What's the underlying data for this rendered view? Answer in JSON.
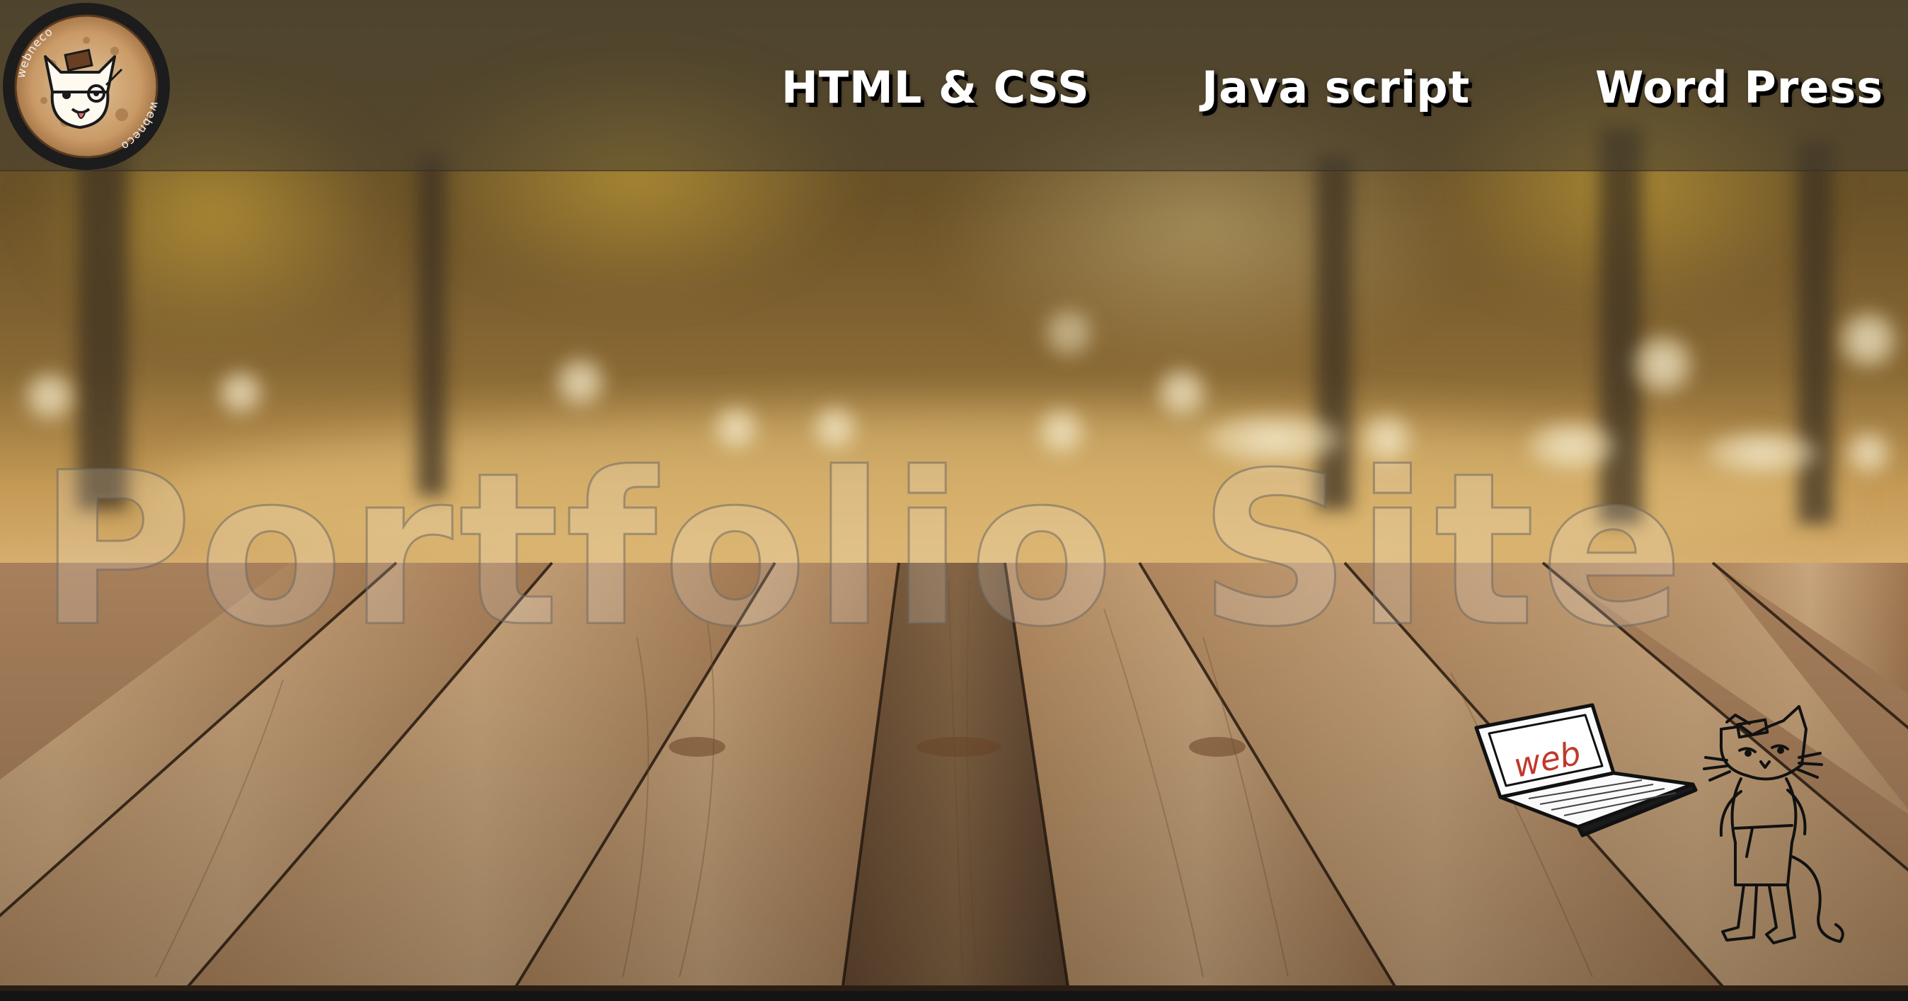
{
  "header": {
    "logo": {
      "name": "webneco cat logo",
      "text_top": "webneco",
      "text_bottom": "webneco"
    },
    "nav": [
      {
        "label": "HTML & CSS"
      },
      {
        "label": "Java script"
      },
      {
        "label": "Word Press"
      }
    ]
  },
  "hero": {
    "title": "Portfolio Site"
  },
  "illustration": {
    "laptop_screen_text": "web",
    "description_icon": "cat-with-laptop-illustration"
  },
  "colors": {
    "header_overlay": "#463e30",
    "nav_text": "#ffffff",
    "nav_shadow": "#000000",
    "wood_light": "#c9a27a",
    "wood_dark": "#6b4a2e",
    "forest_top": "#4a3f22",
    "forest_glow": "#d8b86a"
  }
}
